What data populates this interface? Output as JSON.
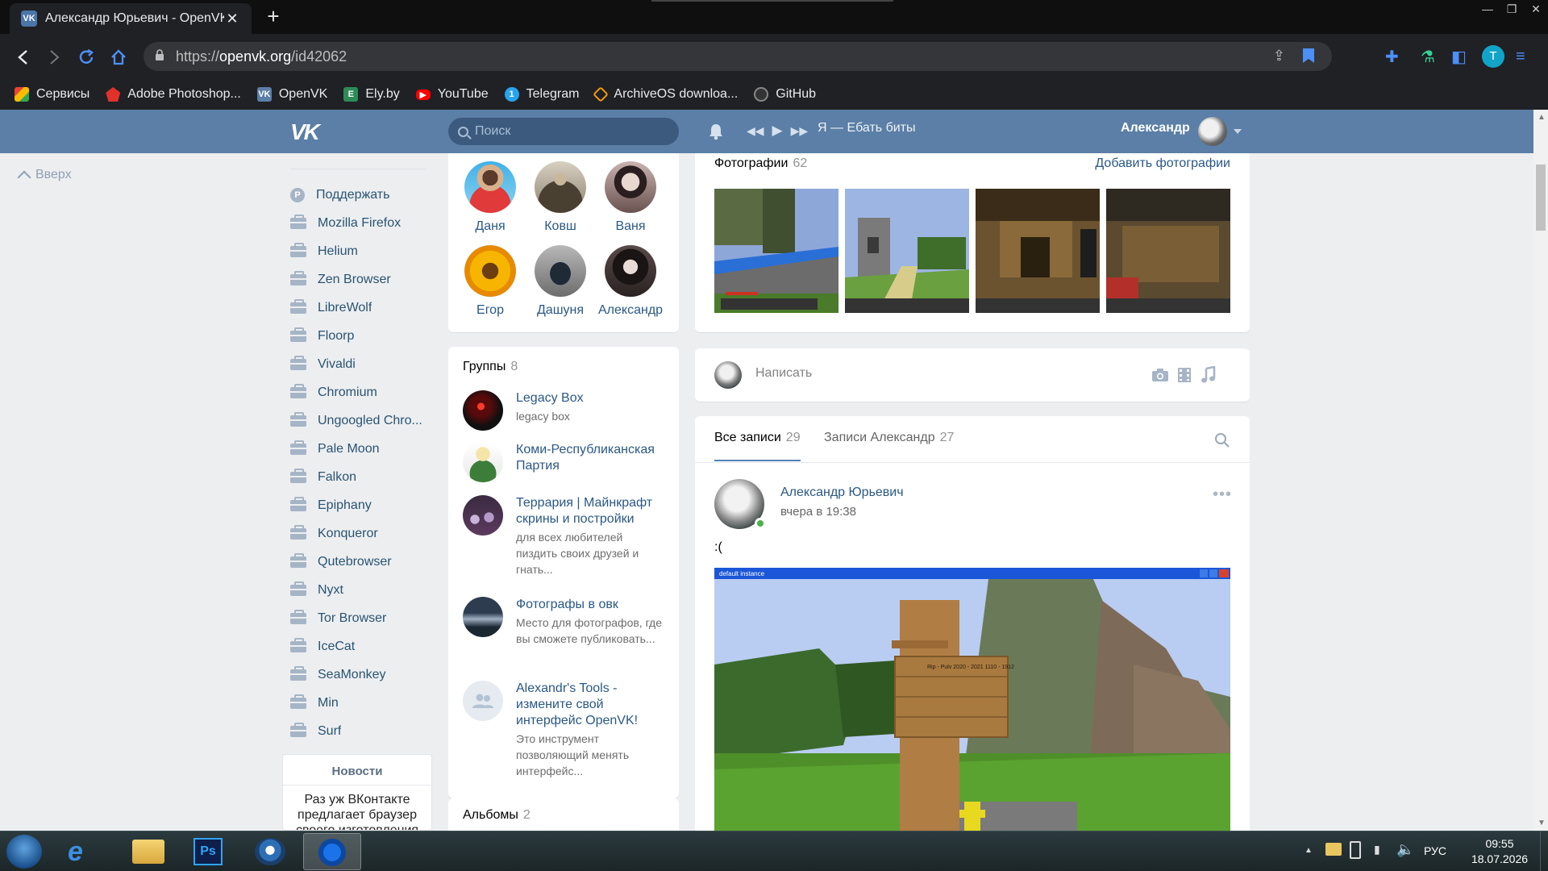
{
  "browser": {
    "tab_title": "Александр Юрьевич - OpenVK",
    "url_scheme": "https://",
    "url_host": "openvk.org",
    "url_path": "/id42062",
    "profile_initial": "T",
    "bookmarks": [
      {
        "label": "Сервисы",
        "icon": "apps-grid-icon"
      },
      {
        "label": "Adobe Photoshop...",
        "icon": "photoshop-icon"
      },
      {
        "label": "OpenVK",
        "icon": "openvk-icon"
      },
      {
        "label": "Ely.by",
        "icon": "elyby-icon"
      },
      {
        "label": "YouTube",
        "icon": "youtube-icon"
      },
      {
        "label": "Telegram",
        "icon": "telegram-icon"
      },
      {
        "label": "ArchiveOS downloa...",
        "icon": "archiveos-icon"
      },
      {
        "label": "GitHub",
        "icon": "github-icon"
      }
    ]
  },
  "header": {
    "search_placeholder": "Поиск",
    "now_playing": "Я — Ебать биты",
    "user_name": "Александр"
  },
  "sidebar": {
    "up_label": "Вверх",
    "items": [
      {
        "label": "Поддержать",
        "icon": "support-icon"
      },
      {
        "label": "Mozilla Firefox",
        "icon": "briefcase-icon"
      },
      {
        "label": "Helium",
        "icon": "briefcase-icon"
      },
      {
        "label": "Zen Browser",
        "icon": "briefcase-icon"
      },
      {
        "label": "LibreWolf",
        "icon": "briefcase-icon"
      },
      {
        "label": "Floorp",
        "icon": "briefcase-icon"
      },
      {
        "label": "Vivaldi",
        "icon": "briefcase-icon"
      },
      {
        "label": "Chromium",
        "icon": "briefcase-icon"
      },
      {
        "label": "Ungoogled Chro...",
        "icon": "briefcase-icon"
      },
      {
        "label": "Pale Moon",
        "icon": "briefcase-icon"
      },
      {
        "label": "Falkon",
        "icon": "briefcase-icon"
      },
      {
        "label": "Epiphany",
        "icon": "briefcase-icon"
      },
      {
        "label": "Konqueror",
        "icon": "briefcase-icon"
      },
      {
        "label": "Qutebrowser",
        "icon": "briefcase-icon"
      },
      {
        "label": "Nyxt",
        "icon": "briefcase-icon"
      },
      {
        "label": "Tor Browser",
        "icon": "briefcase-icon"
      },
      {
        "label": "IceCat",
        "icon": "briefcase-icon"
      },
      {
        "label": "SeaMonkey",
        "icon": "briefcase-icon"
      },
      {
        "label": "Min",
        "icon": "briefcase-icon"
      },
      {
        "label": "Surf",
        "icon": "briefcase-icon"
      }
    ],
    "news": {
      "title": "Новости",
      "text": "Раз уж ВКонтакте предлагает браузер своего изготовления"
    }
  },
  "friends": [
    {
      "name": "Даня"
    },
    {
      "name": "Ковш"
    },
    {
      "name": "Ваня"
    },
    {
      "name": "Егор"
    },
    {
      "name": "Дашуня"
    },
    {
      "name": "Александр"
    }
  ],
  "groups": {
    "title": "Группы",
    "count": "8",
    "items": [
      {
        "name": "Legacy Box",
        "desc": "legacy box"
      },
      {
        "name": "Коми-Республиканская Партия",
        "desc": ""
      },
      {
        "name": "Террария | Майнкрафт скрины и постройки",
        "desc": "для всех любителей пиздить своих друзей и гнать..."
      },
      {
        "name": "Фотографы в овк",
        "desc": "Место для фотографов, где вы сможете публиковать..."
      },
      {
        "name": "Alexandr's Tools - измените свой интерфейс OpenVK!",
        "desc": "Это инструмент позволяющий менять интерфейс..."
      }
    ]
  },
  "albums": {
    "title": "Альбомы",
    "count": "2"
  },
  "photos": {
    "title": "Фотографии",
    "count": "62",
    "add_label": "Добавить фотографии"
  },
  "compose": {
    "placeholder": "Написать"
  },
  "feed": {
    "tabs": [
      {
        "label": "Все записи",
        "count": "29"
      },
      {
        "label": "Записи Александр",
        "count": "27"
      }
    ],
    "post": {
      "author": "Александр Юрьевич",
      "time": "вчера в 19:38",
      "text": ":(",
      "window_title": "default instance",
      "sign_text": "Rip - Pulv 2020 - 2021 1110 - 1912"
    }
  },
  "taskbar": {
    "lang": "РУС",
    "time": "09:55",
    "date": "18.07.2026"
  },
  "colors": {
    "vk_header": "#5b7fa6",
    "link": "#2a5885",
    "accent": "#5181b8"
  }
}
